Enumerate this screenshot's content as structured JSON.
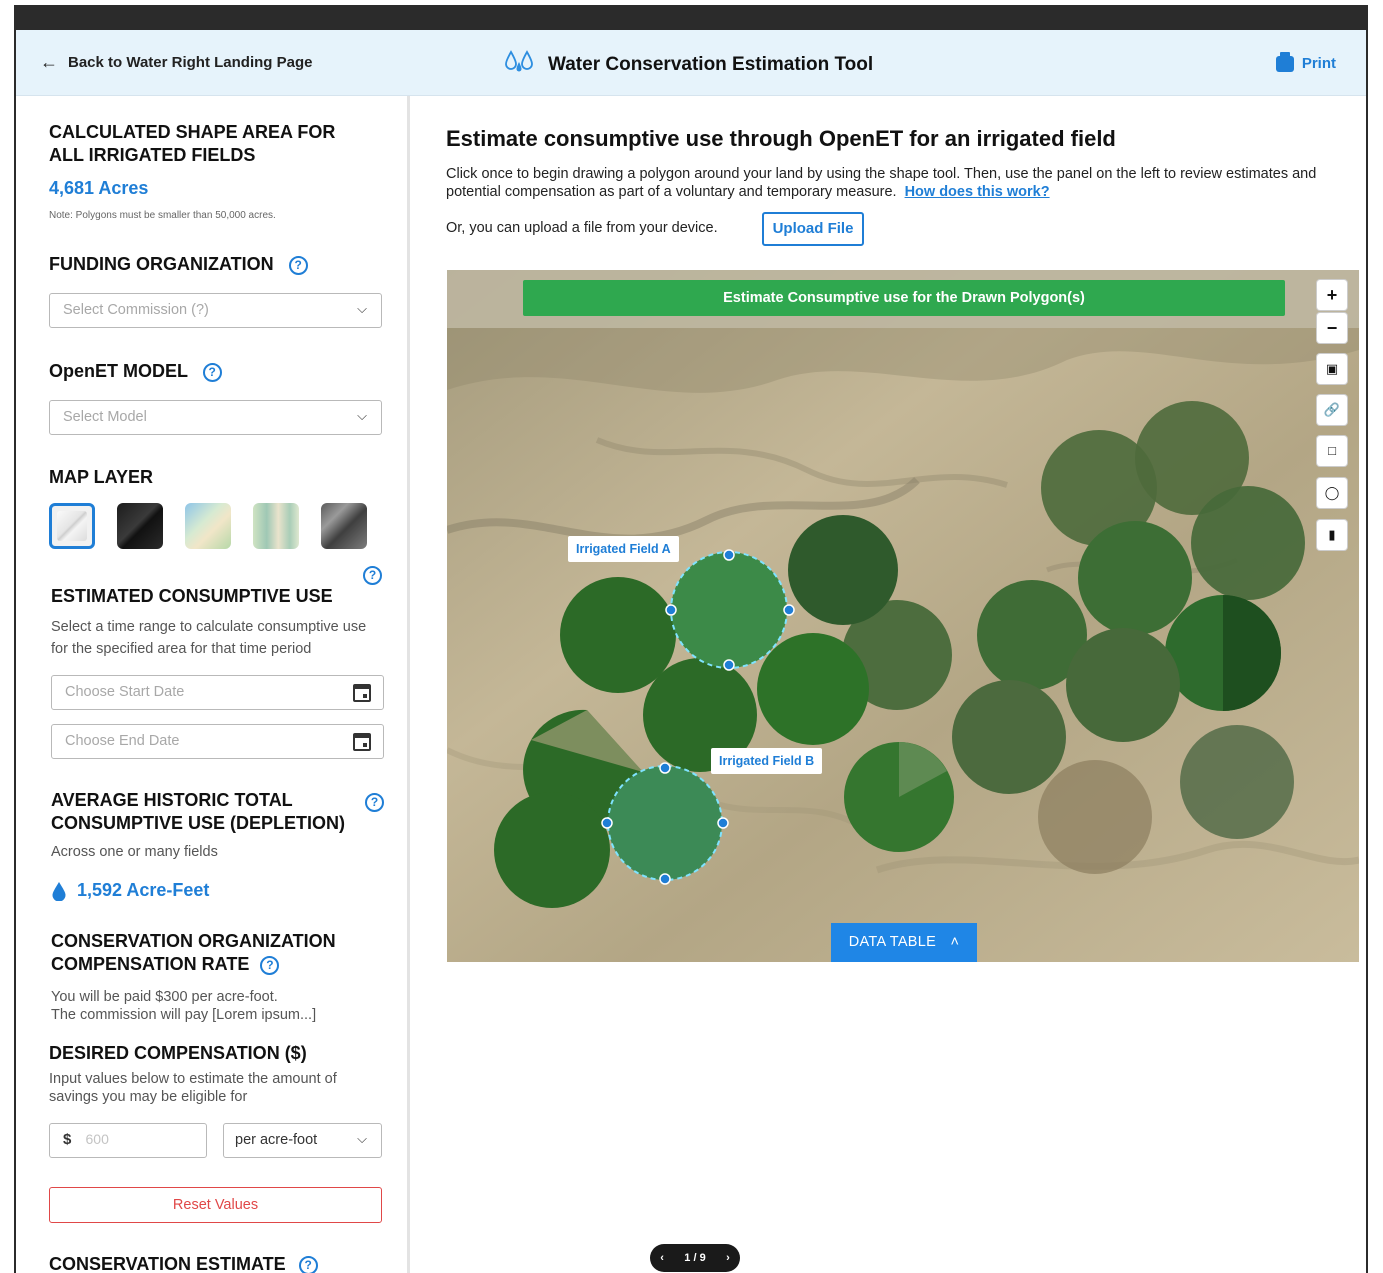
{
  "header": {
    "back_label": "Back to Water Right Landing Page",
    "title": "Water Conservation Estimation Tool",
    "print_label": "Print"
  },
  "sidebar": {
    "area_heading": "CALCULATED SHAPE AREA FOR ALL IRRIGATED FIELDS",
    "area_value": "4,681 Acres",
    "area_note": "Note: Polygons must be smaller than 50,000 acres.",
    "funding_heading": "FUNDING ORGANIZATION",
    "funding_placeholder": "Select Commission (?)",
    "model_heading": "OpenET MODEL",
    "model_placeholder": "Select Model",
    "map_layer_heading": "MAP LAYER",
    "map_layers": [
      "light",
      "dark",
      "streets",
      "terrain",
      "satellite"
    ],
    "consumptive_heading": "ESTIMATED CONSUMPTIVE USE",
    "consumptive_text": "Select a time range to calculate consumptive use for the specified area for that time period",
    "start_date_placeholder": "Choose Start Date",
    "end_date_placeholder": "Choose End Date",
    "historic_heading": "AVERAGE HISTORIC TOTAL CONSUMPTIVE USE (DEPLETION)",
    "historic_sub": "Across one or many fields",
    "historic_value": "1,592 Acre-Feet",
    "rate_heading_line1": "CONSERVATION ORGANIZATION",
    "rate_heading_line2": "COMPENSATION RATE",
    "rate_text_1": "You will be paid $300 per acre-foot.",
    "rate_text_2": "The commission will pay [Lorem ipsum...]",
    "desired_heading": "DESIRED COMPENSATION ($)",
    "desired_text": "Input values below to estimate the amount of savings you may be eligible for",
    "currency_symbol": "$",
    "amount_placeholder": "600",
    "unit_value": "per acre-foot",
    "reset_label": "Reset Values",
    "estimate_heading": "CONSERVATION ESTIMATE"
  },
  "main": {
    "title": "Estimate consumptive use through OpenET for an irrigated field",
    "description": "Click once to begin drawing a polygon around your land by using the shape tool. Then, use the panel on the left to review estimates and potential compensation as part of a voluntary and temporary measure.",
    "how_link": "How does this work?",
    "upload_text": "Or, you can upload a file from your device.",
    "upload_button": "Upload File",
    "estimate_button": "Estimate Consumptive use for the Drawn Polygon(s)",
    "field_a_label": "Irrigated Field A",
    "field_b_label": "Irrigated Field B",
    "data_table_label": "DATA TABLE",
    "pager_text": "1 / 9"
  },
  "colors": {
    "accent": "#1f7ed6",
    "estimate_green": "#2fa84f",
    "reset_red": "#e04848",
    "header_bg": "#e6f3fb"
  }
}
